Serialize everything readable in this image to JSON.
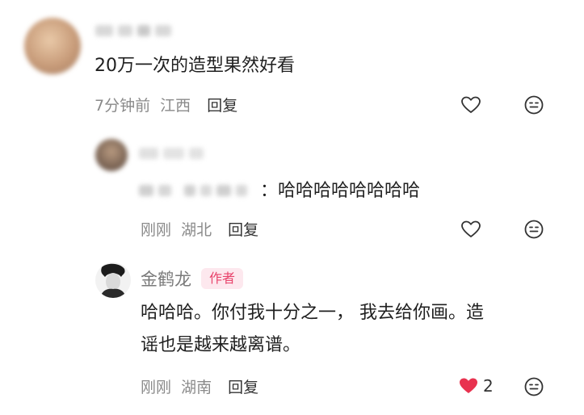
{
  "comments": [
    {
      "text": "20万一次的造型果然好看",
      "time": "7分钟前",
      "location": "江西",
      "reply_label": "回复"
    },
    {
      "text": "哈哈哈哈哈哈哈哈",
      "separator": "：",
      "time": "刚刚",
      "location": "湖北",
      "reply_label": "回复"
    },
    {
      "author": "金鹤龙",
      "author_tag": "作者",
      "text_line1": "哈哈哈。你付我十分之一， 我去给你画。造",
      "text_line2": "谣也是越来越离谱。",
      "time": "刚刚",
      "location": "湖南",
      "reply_label": "回复",
      "like_count": "2"
    }
  ],
  "colors": {
    "liked": "#e8324f",
    "tag_text": "#e8436b",
    "tag_bg": "#fde8ee",
    "meta": "#8a8a8a"
  },
  "icons": [
    "heart-outline-icon",
    "emoji-face-icon",
    "heart-filled-icon"
  ]
}
